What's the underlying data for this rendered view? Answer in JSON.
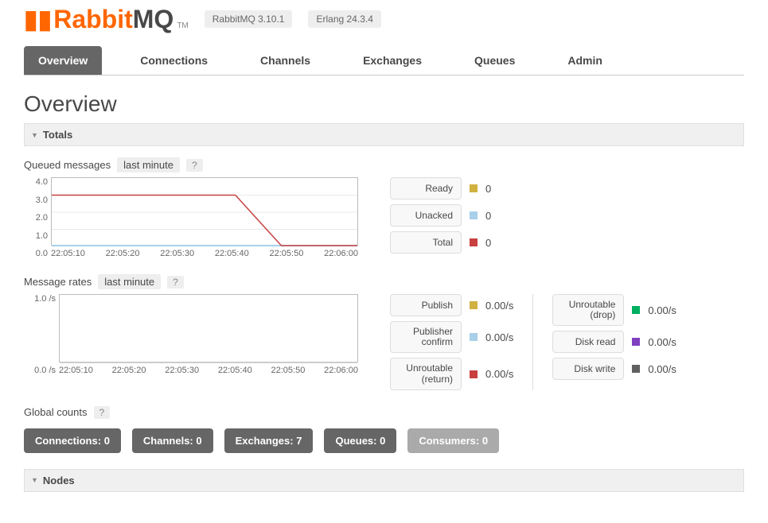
{
  "header": {
    "logo_prefix": "Rabbit",
    "logo_suffix": "MQ",
    "tm": "TM",
    "version": "RabbitMQ 3.10.1",
    "erlang": "Erlang 24.3.4"
  },
  "nav": {
    "items": [
      "Overview",
      "Connections",
      "Channels",
      "Exchanges",
      "Queues",
      "Admin"
    ],
    "active": 0
  },
  "page_title": "Overview",
  "sections": {
    "totals": "Totals",
    "nodes": "Nodes"
  },
  "queued": {
    "label": "Queued messages",
    "range": "last minute",
    "y_ticks": [
      "4.0",
      "3.0",
      "2.0",
      "1.0",
      "0.0"
    ],
    "x_ticks": [
      "22:05:10",
      "22:05:20",
      "22:05:30",
      "22:05:40",
      "22:05:50",
      "22:06:00"
    ],
    "legend": [
      {
        "label": "Ready",
        "color": "#d1b140",
        "value": "0"
      },
      {
        "label": "Unacked",
        "color": "#a8d0e8",
        "value": "0"
      },
      {
        "label": "Total",
        "color": "#c84040",
        "value": "0"
      }
    ]
  },
  "rates": {
    "label": "Message rates",
    "range": "last minute",
    "y_ticks": [
      "1.0 /s",
      "0.0 /s"
    ],
    "x_ticks": [
      "22:05:10",
      "22:05:20",
      "22:05:30",
      "22:05:40",
      "22:05:50",
      "22:06:00"
    ],
    "left_legend": [
      {
        "label": "Publish",
        "color": "#d1b140",
        "value": "0.00/s"
      },
      {
        "label": "Publisher confirm",
        "color": "#a8d0e8",
        "value": "0.00/s"
      },
      {
        "label": "Unroutable (return)",
        "color": "#c84040",
        "value": "0.00/s"
      }
    ],
    "right_legend": [
      {
        "label": "Unroutable (drop)",
        "color": "#00b060",
        "value": "0.00/s"
      },
      {
        "label": "Disk read",
        "color": "#8040c0",
        "value": "0.00/s"
      },
      {
        "label": "Disk write",
        "color": "#606060",
        "value": "0.00/s"
      }
    ]
  },
  "global_counts": {
    "label": "Global counts",
    "items": [
      {
        "label": "Connections:",
        "value": "0",
        "muted": false
      },
      {
        "label": "Channels:",
        "value": "0",
        "muted": false
      },
      {
        "label": "Exchanges:",
        "value": "7",
        "muted": false
      },
      {
        "label": "Queues:",
        "value": "0",
        "muted": false
      },
      {
        "label": "Consumers:",
        "value": "0",
        "muted": true
      }
    ]
  },
  "chart_data": [
    {
      "type": "line",
      "title": "Queued messages last minute",
      "xlabel": "",
      "ylabel": "",
      "x": [
        "22:05:10",
        "22:05:20",
        "22:05:30",
        "22:05:40",
        "22:05:50",
        "22:06:00"
      ],
      "series": [
        {
          "name": "Ready",
          "values": [
            0,
            0,
            0,
            0,
            0,
            0
          ]
        },
        {
          "name": "Unacked",
          "values": [
            0,
            0,
            0,
            0,
            0,
            0
          ]
        },
        {
          "name": "Total",
          "values": [
            3,
            3,
            3,
            3,
            0,
            0
          ]
        }
      ],
      "ylim": [
        0,
        4
      ]
    },
    {
      "type": "line",
      "title": "Message rates last minute",
      "xlabel": "",
      "ylabel": "/s",
      "x": [
        "22:05:10",
        "22:05:20",
        "22:05:30",
        "22:05:40",
        "22:05:50",
        "22:06:00"
      ],
      "series": [
        {
          "name": "Publish",
          "values": [
            0,
            0,
            0,
            0,
            0,
            0
          ]
        },
        {
          "name": "Publisher confirm",
          "values": [
            0,
            0,
            0,
            0,
            0,
            0
          ]
        },
        {
          "name": "Unroutable (return)",
          "values": [
            0,
            0,
            0,
            0,
            0,
            0
          ]
        },
        {
          "name": "Unroutable (drop)",
          "values": [
            0,
            0,
            0,
            0,
            0,
            0
          ]
        },
        {
          "name": "Disk read",
          "values": [
            0,
            0,
            0,
            0,
            0,
            0
          ]
        },
        {
          "name": "Disk write",
          "values": [
            0,
            0,
            0,
            0,
            0,
            0
          ]
        }
      ],
      "ylim": [
        0,
        1
      ]
    }
  ]
}
